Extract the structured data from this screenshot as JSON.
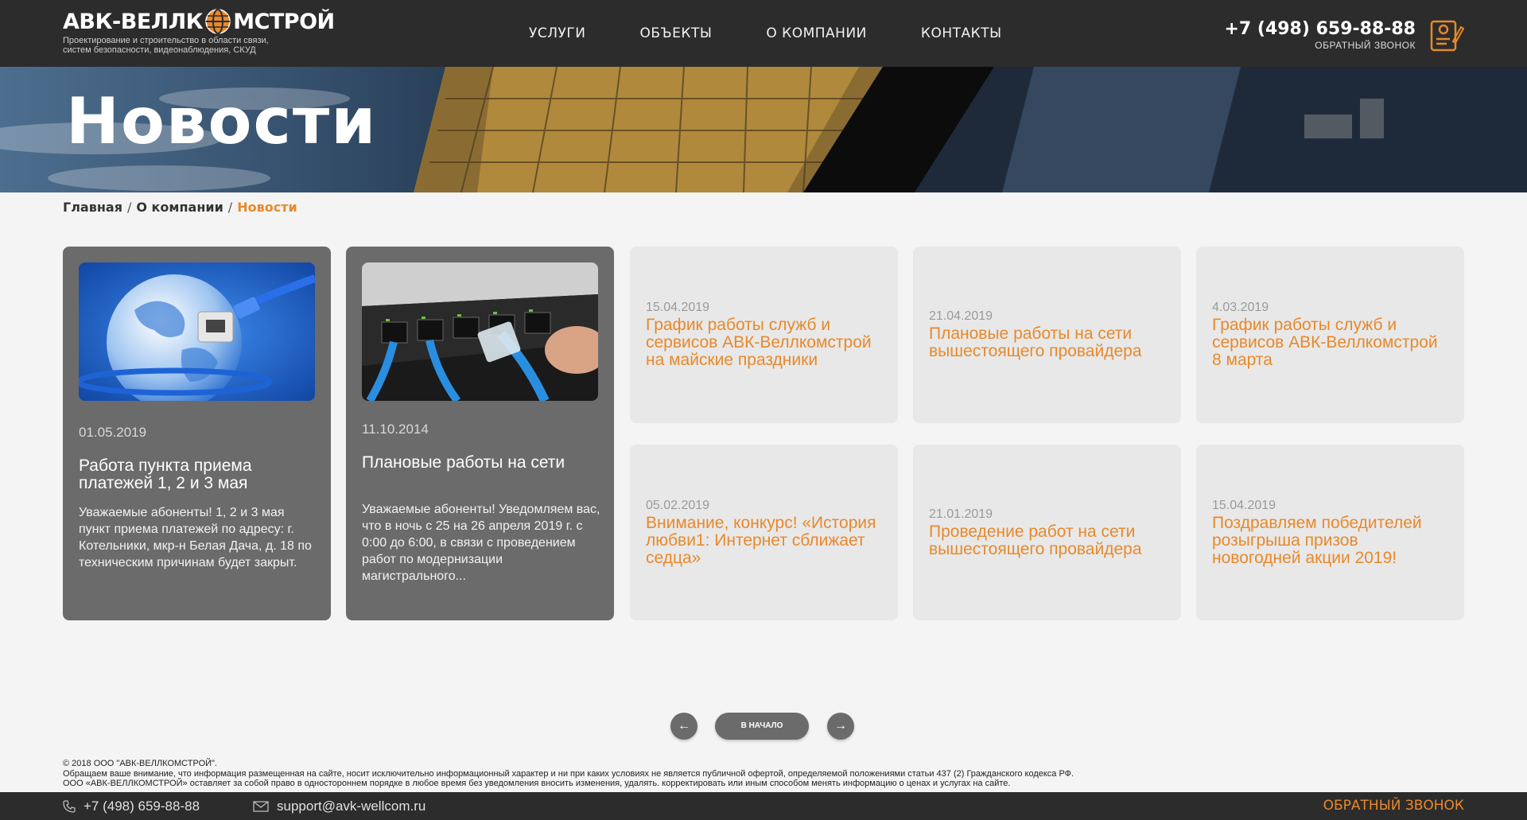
{
  "header": {
    "logo_left": "АВК-ВЕЛЛК",
    "logo_right": "МСТРОЙ",
    "logo_sub_1": "Проектирование и строительство в области связи,",
    "logo_sub_2": "систем безопасности, видеонаблюдения, СКУД",
    "nav": [
      {
        "label": "УСЛУГИ"
      },
      {
        "label": "ОБЪЕКТЫ"
      },
      {
        "label": "О КОМПАНИИ"
      },
      {
        "label": "КОНТАКТЫ"
      }
    ],
    "phone": "+7 (498) 659-88-88",
    "callback": "ОБРАТНЫЙ ЗВОНОК"
  },
  "hero": {
    "title": "Новости"
  },
  "breadcrumb": {
    "home": "Главная",
    "sep": "/",
    "about": "О компании",
    "current": "Новости"
  },
  "cards_featured": [
    {
      "date": "01.05.2019",
      "title": "Работа пункта приема платежей  1, 2 и 3 мая",
      "text": "Уважаемые абоненты! 1, 2 и 3 мая пункт приема платежей по адресу: г. Котельники, мкр-н Белая Дача, д. 18 по техническим причинам будет закрыт."
    },
    {
      "date": "11.10.2014",
      "title": "Плановые работы на сети",
      "text": "Уважаемые абоненты! Уведомляем вас, что в ночь с 25 на 26 апреля 2019 г. с 0:00 до 6:00, в связи с проведением работ по модернизации магистрального..."
    }
  ],
  "cards_list": [
    {
      "date": "15.04.2019",
      "title": "График работы служб и сервисов АВК-Веллкомстрой на майские праздники"
    },
    {
      "date": "21.04.2019",
      "title": "Плановые работы на сети вышестоящего провайдера"
    },
    {
      "date": "4.03.2019",
      "title": "График работы служб и сервисов АВК-Веллкомстрой 8 марта"
    },
    {
      "date": "05.02.2019",
      "title": "Внимание, конкурс! «История любви1: Интернет сближает седца»"
    },
    {
      "date": "21.01.2019",
      "title": "Проведение работ на сети вышестоящего провайдера"
    },
    {
      "date": "15.04.2019",
      "title": "Поздравляем победителей розыгрыша призов новогодней акции 2019!"
    }
  ],
  "pager": {
    "prev": "←",
    "start": "В НАЧАЛО",
    "next": "→"
  },
  "legal": {
    "line1": "© 2018 ООО \"АВК-ВЕЛЛКОМСТРОЙ\".",
    "line2": "Обращаем ваше внимание, что информация размещенная на сайте, носит исключительно информационный характер и ни при каких условиях не является публичной офертой, определяемой положениями статьи 437 (2) Гражданского кодекса РФ.",
    "line3": "ООО «АВК-ВЕЛЛКОМСТРОЙ» оставляет за собой право в одностороннем порядке в любое время без уведомления вносить изменения, удалять. корректировать или иным способом менять информацию о ценах и услугах на сайте."
  },
  "footer": {
    "phone": "+7 (498) 659-88-88",
    "email": "support@avk-wellcom.ru",
    "callback": "ОБРАТНЫЙ ЗВОНОК"
  },
  "colors": {
    "accent": "#e8892a",
    "dark": "#2c2c2c",
    "card_dark": "#6b6b6b",
    "card_light": "#e8e8e8"
  }
}
